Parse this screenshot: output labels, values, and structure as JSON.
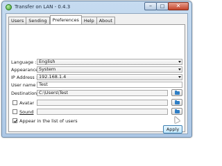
{
  "window": {
    "title": "Transfer on LAN - 0.4.3",
    "minimize_glyph": "–",
    "maximize_glyph": "□",
    "close_glyph": "✕"
  },
  "tabs": [
    {
      "label": "Users",
      "active": false
    },
    {
      "label": "Sending",
      "active": false
    },
    {
      "label": "Preferences",
      "active": true
    },
    {
      "label": "Help",
      "active": false
    },
    {
      "label": "About",
      "active": false
    }
  ],
  "preferences": {
    "language": {
      "label": "Language :",
      "value": "English"
    },
    "appearance": {
      "label": "Appearance :",
      "value": "System"
    },
    "ip_address": {
      "label": "IP Address :",
      "value": "192.168.1.4"
    },
    "user_name": {
      "label": "User name :",
      "value": "Test"
    },
    "destination": {
      "label": "Destination :",
      "value": "C:\\Users\\Test"
    },
    "avatar": {
      "label": "Avatar",
      "checked": false,
      "value": ""
    },
    "sound": {
      "label": "Sound",
      "checked": false,
      "value": ""
    },
    "appear_in_list": {
      "label": "Appear in the list of users",
      "checked": true
    }
  },
  "actions": {
    "apply_label": "Apply"
  },
  "icons": {
    "browse": "folder-icon",
    "app": "app-icon"
  },
  "colors": {
    "accent": "#2f7fc6",
    "title_bar": "#c6dbf0",
    "close_button": "#c4432a"
  }
}
